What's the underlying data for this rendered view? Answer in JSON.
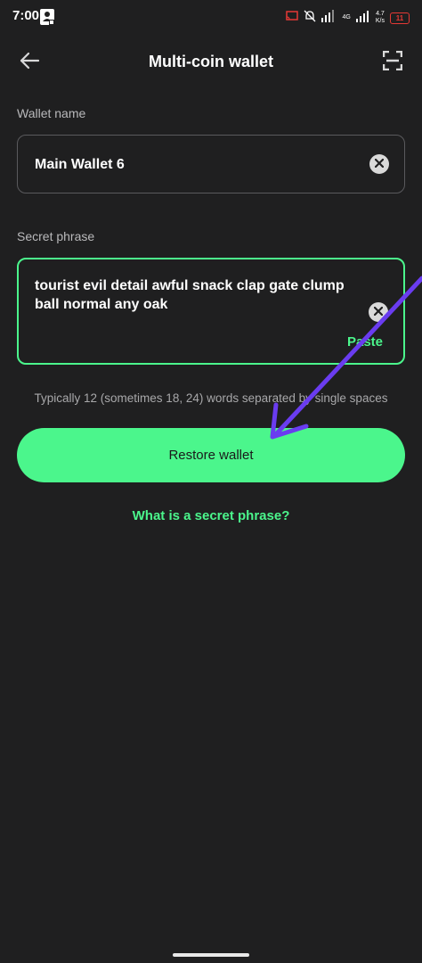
{
  "status_bar": {
    "time": "7:00",
    "network_speed_value": "4.7",
    "network_speed_unit": "K/s",
    "network_type": "4G",
    "battery_level": "11"
  },
  "header": {
    "title": "Multi-coin wallet",
    "back_icon": "arrow-left-icon",
    "scan_icon": "scan-icon"
  },
  "wallet_name": {
    "label": "Wallet name",
    "value": "Main Wallet 6"
  },
  "secret_phrase": {
    "label": "Secret phrase",
    "value": "tourist evil detail awful snack clap gate clump ball normal any oak",
    "paste_label": "Paste"
  },
  "hint": "Typically 12 (sometimes 18, 24) words separated by single spaces",
  "restore_button": {
    "label": "Restore wallet"
  },
  "help_link": "What is a secret phrase?",
  "colors": {
    "background": "#1f1f20",
    "accent": "#4bf68c",
    "annotation": "#6a3cf0"
  }
}
